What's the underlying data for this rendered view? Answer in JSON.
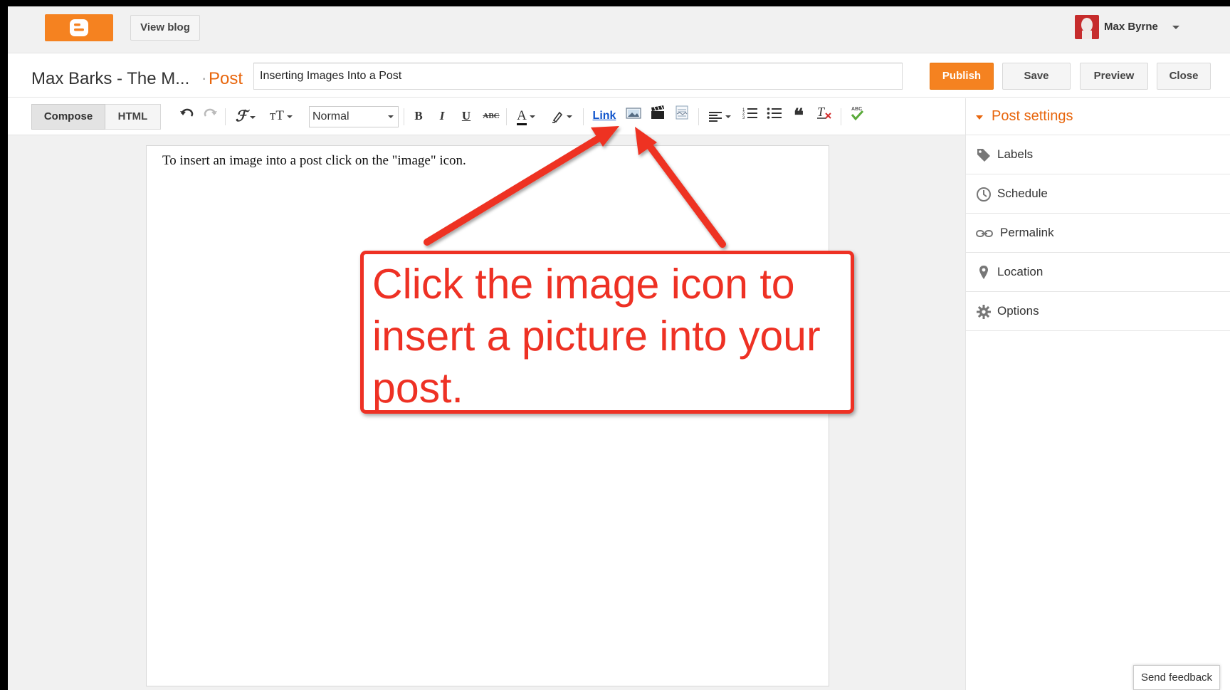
{
  "topbar": {
    "view_blog_label": "View blog",
    "user_name": "Max Byrne"
  },
  "titlebar": {
    "blog_name": "Max Barks - The M...",
    "separator": "·",
    "section_label": "Post",
    "post_title_value": "Inserting Images Into a Post",
    "publish_label": "Publish",
    "save_label": "Save",
    "preview_label": "Preview",
    "close_label": "Close"
  },
  "toolbar": {
    "compose_tab": "Compose",
    "html_tab": "HTML",
    "undo_icon": "undo-icon",
    "redo_icon": "redo-icon",
    "font_icon": "font-family-icon",
    "fontsize_icon": "font-size-icon",
    "format_value": "Normal",
    "bold": "B",
    "italic": "I",
    "underline": "U",
    "strike": "ABC",
    "text_color": "A",
    "link_label": "Link",
    "image_icon": "image-icon",
    "video_icon": "video-icon",
    "jump_break_icon": "jump-break-icon",
    "align_icon": "align-icon",
    "numbered_list_icon": "numbered-list-icon",
    "bullet_list_icon": "bullet-list-icon",
    "quote_icon": "quote-icon",
    "remove_format_icon": "remove-formatting-icon",
    "spellcheck_icon": "spellcheck-icon"
  },
  "editor": {
    "body_text": "To insert an image into a post click on the \"image\" icon."
  },
  "sidebar": {
    "title": "Post settings",
    "items": [
      {
        "label": "Labels",
        "icon": "tag-icon"
      },
      {
        "label": "Schedule",
        "icon": "clock-icon"
      },
      {
        "label": "Permalink",
        "icon": "link-icon"
      },
      {
        "label": "Location",
        "icon": "pin-icon"
      },
      {
        "label": "Options",
        "icon": "gear-icon"
      }
    ]
  },
  "feedback_label": "Send feedback",
  "annotation": {
    "callout_text": "Click the image icon to insert a picture into your post."
  },
  "colors": {
    "brand_orange": "#f58220",
    "annotation_red": "#ee3124",
    "post_settings_orange": "#e8660d",
    "link_blue": "#1155cc"
  }
}
